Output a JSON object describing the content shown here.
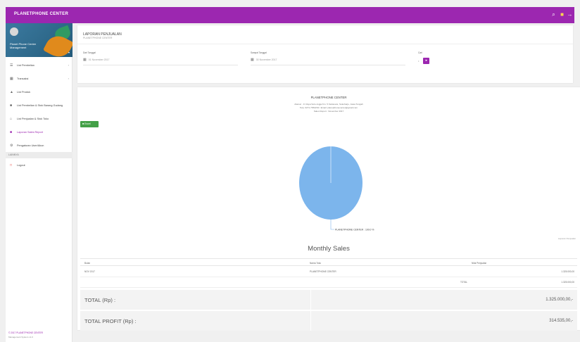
{
  "app": {
    "brand": "PLANETPHONE CENTER",
    "top_icons": [
      "search-icon",
      "bell-icon",
      "logout-icon"
    ]
  },
  "sidebar": {
    "profile_name": "Planet Phone Center",
    "profile_role": "Management",
    "items": [
      {
        "label": "List Pembelian",
        "icon": "list-icon",
        "caret": true,
        "active": false
      },
      {
        "label": "Transaksi",
        "icon": "grid-icon",
        "caret": true,
        "active": false
      },
      {
        "label": "List Produk",
        "icon": "tag-icon",
        "caret": false,
        "active": false
      },
      {
        "label": "List Pembelian & Stok Barang Gudang",
        "icon": "box-icon",
        "caret": false,
        "active": false
      },
      {
        "label": "List Penjualan & Stok Toko",
        "icon": "store-icon",
        "caret": false,
        "active": false
      },
      {
        "label": "Laporan Sales Report",
        "icon": "report-icon",
        "caret": false,
        "active": true
      },
      {
        "label": "Pengaturan User/Akun",
        "icon": "settings-icon",
        "caret": false,
        "active": false
      }
    ],
    "section_label": "LAINNYA",
    "logout_label": "Logout",
    "footer_copy": "© 2017 PLANETPHONE CENTER",
    "footer_ver": "Management System v1.0"
  },
  "header_card": {
    "title": "LAPORAN PENJUALAN",
    "subtitle": "PLANETPHONE CENTER",
    "filters": [
      {
        "label": "Dari Tanggal",
        "value": "01 November 2017"
      },
      {
        "label": "Sampai Tanggal",
        "value": "30 November 2017"
      },
      {
        "label": "Cari",
        "value": ""
      }
    ]
  },
  "report": {
    "title": "PLANETPHONE CENTER",
    "address": "Alamat : Jl. Raya Solo-Jogja Km. 5 Kartasura, Sukoharjo, Jawa Tengah",
    "contact": "Telp. 0271-7652232 / Email: planetphonecenter@gmail.com",
    "period": "Sales Report : November 2017",
    "excel_label": "Excel",
    "export_note": "Laporan Penjualan",
    "pie_label": "PLANETPHONE CENTER : 100.0 %",
    "pie_color": "#7cb5ec"
  },
  "chart_data": {
    "type": "pie",
    "slices": [
      {
        "name": "PLANETPHONE CENTER",
        "value": 100.0
      }
    ],
    "colors": [
      "#7cb5ec"
    ]
  },
  "table": {
    "title": "Monthly Sales",
    "headers": [
      "Bulan",
      "Nama Toko",
      "Nilai Penjualan"
    ],
    "rows": [
      [
        "NOV 2017",
        "PLANETPHONE CENTER",
        "",
        "1.325.000,00"
      ],
      [
        "",
        "",
        "TOTAL",
        "1.325.000,00"
      ]
    ],
    "total_label": "TOTAL (Rp) :",
    "total_value": "1.325.000,00,-",
    "profit_label": "TOTAL PROFIT (Rp) :",
    "profit_value": "314.535,00,-"
  }
}
